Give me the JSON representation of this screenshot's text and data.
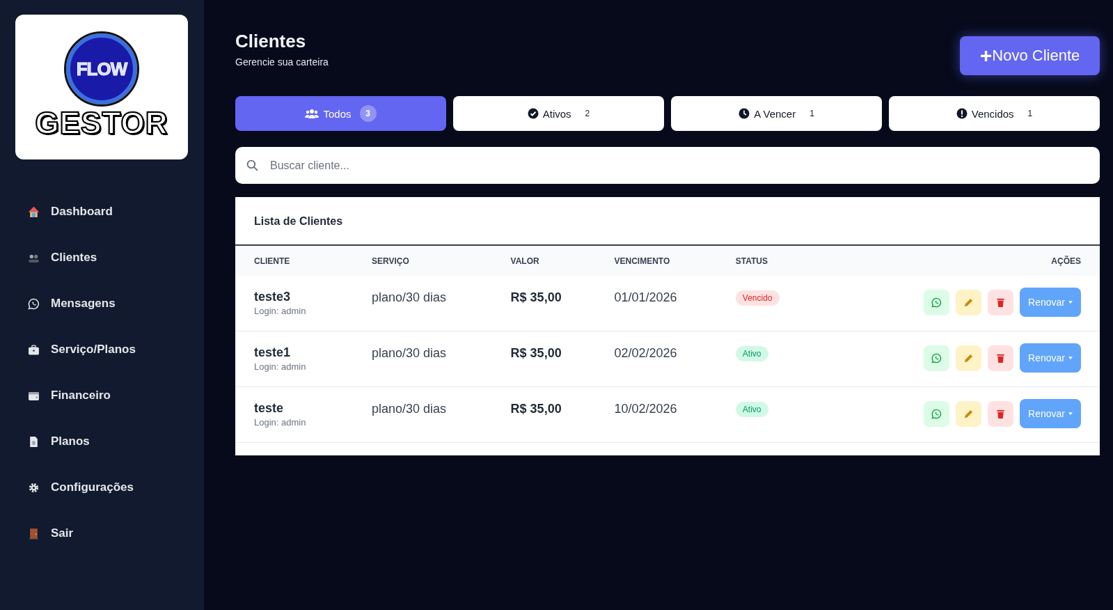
{
  "logo": {
    "badge_text": "FLOW",
    "wordmark": "GESTOR"
  },
  "sidebar": {
    "items": [
      {
        "label": "Dashboard",
        "selected": false
      },
      {
        "label": "Clientes",
        "selected": false
      },
      {
        "label": "Mensagens",
        "selected": false
      },
      {
        "label": "Serviço/Planos",
        "selected": false
      },
      {
        "label": "Financeiro",
        "selected": false
      },
      {
        "label": "Planos",
        "selected": false
      },
      {
        "label": "Configurações",
        "selected": false
      },
      {
        "label": "Sair",
        "selected": false
      }
    ]
  },
  "header": {
    "title": "Clientes",
    "subtitle": "Gerencie sua carteira",
    "new_button": {
      "icon": "+",
      "label": "Novo Cliente"
    }
  },
  "tabs": [
    {
      "label": "Todos",
      "count": "3",
      "selected": true
    },
    {
      "label": "Ativos",
      "count": "2",
      "selected": false
    },
    {
      "label": "A Vencer",
      "count": "1",
      "selected": false
    },
    {
      "label": "Vencidos",
      "count": "1",
      "selected": false
    }
  ],
  "search": {
    "placeholder": "Buscar cliente..."
  },
  "table": {
    "title": "Lista de Clientes",
    "columns": [
      "CLIENTE",
      "SERVIÇO",
      "VALOR",
      "VENCIMENTO",
      "STATUS",
      "AÇÕES"
    ],
    "rows": [
      {
        "name": "teste3",
        "login": "Login: admin",
        "service": "plano/30 dias",
        "value": "R$ 35,00",
        "due": "01/01/2026",
        "status": "Vencido",
        "kind": "expired",
        "renew_label": "Renovar"
      },
      {
        "name": "teste1",
        "login": "Login: admin",
        "service": "plano/30 dias",
        "value": "R$ 35,00",
        "due": "02/02/2026",
        "status": "Ativo",
        "kind": "active",
        "renew_label": "Renovar"
      },
      {
        "name": "teste",
        "login": "Login: admin",
        "service": "plano/30 dias",
        "value": "R$ 35,00",
        "due": "10/02/2026",
        "status": "Ativo",
        "kind": "active",
        "renew_label": "Renovar"
      }
    ]
  }
}
